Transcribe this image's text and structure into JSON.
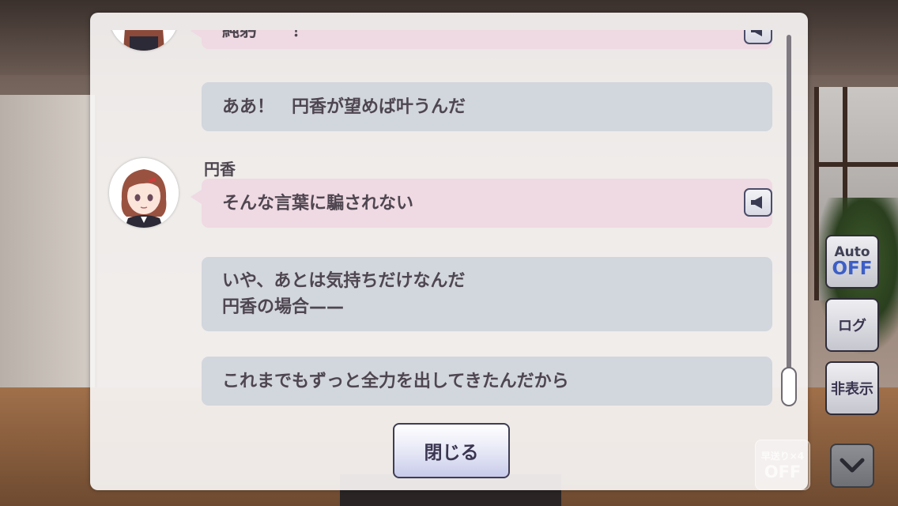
{
  "log": {
    "entries": [
      {
        "type": "voiced",
        "speaker": "",
        "lines": [
          "純躬　　！"
        ],
        "color": "pink"
      },
      {
        "type": "player",
        "lines": [
          "ああ！　円香が望めば叶うんだ"
        ],
        "color": "grey"
      },
      {
        "type": "voiced",
        "speaker": "円香",
        "lines": [
          "そんな言葉に騙されない"
        ],
        "color": "pink"
      },
      {
        "type": "player",
        "lines": [
          "いや、あとは気持ちだけなんだ",
          "円香の場合——"
        ],
        "color": "grey"
      },
      {
        "type": "player",
        "lines": [
          "これまでもずっと全力を出してきたんだから"
        ],
        "color": "grey"
      }
    ],
    "scroll_position": 0.97
  },
  "buttons": {
    "close": "閉じる",
    "auto_label": "Auto",
    "auto_state": "OFF",
    "log": "ログ",
    "hide": "非表示",
    "skip_label": "早送り×4",
    "skip_state": "OFF"
  },
  "icons": {
    "voice": "speaker-icon",
    "down": "chevron-down-icon"
  },
  "colors": {
    "player_bubble": "#d2d6dd",
    "character_bubble": "#efd9e2",
    "auto_off": "#3d5fc6"
  }
}
